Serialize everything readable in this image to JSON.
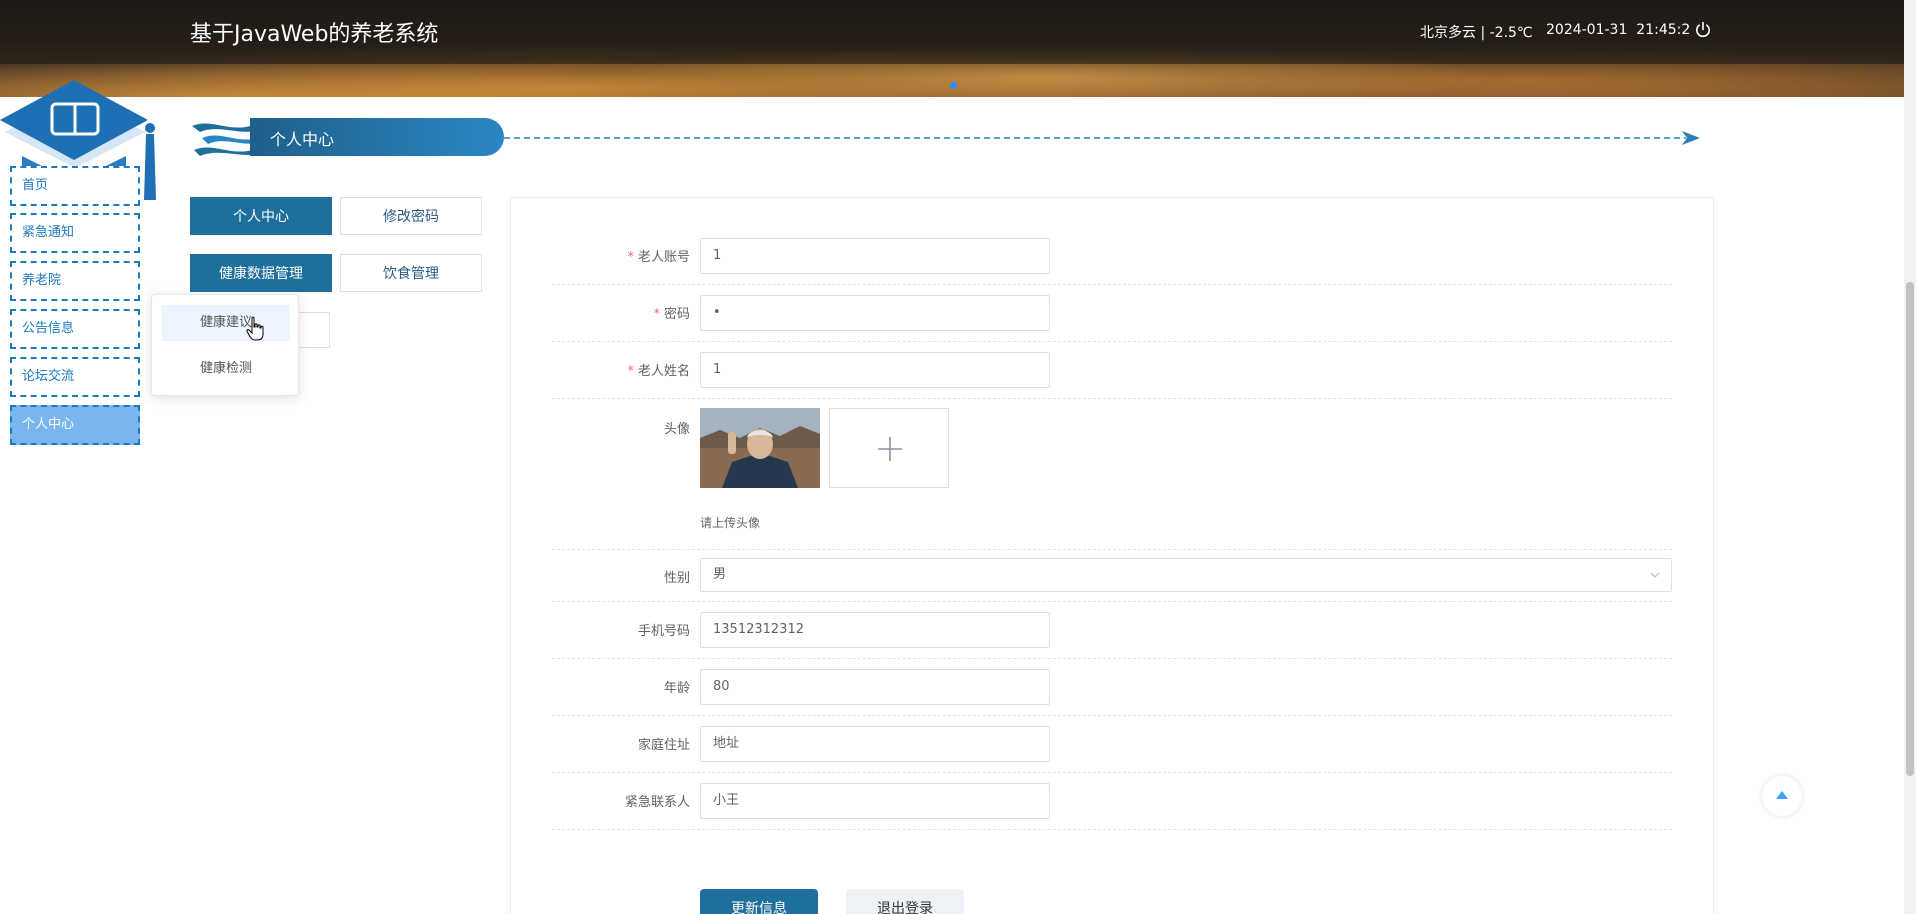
{
  "header": {
    "site_title": "基于JavaWeb的养老系统",
    "weather": "北京多云 | -2.5℃",
    "date": "2024-01-31",
    "time": "21:45:2"
  },
  "sidebar": {
    "items": [
      {
        "label": "首页"
      },
      {
        "label": "紧急通知"
      },
      {
        "label": "养老院"
      },
      {
        "label": "公告信息"
      },
      {
        "label": "论坛交流"
      },
      {
        "label": "个人中心",
        "active": true
      }
    ]
  },
  "section": {
    "title": "个人中心"
  },
  "tabs": {
    "personal_center": "个人中心",
    "change_password": "修改密码",
    "health_data": "健康数据管理",
    "diet": "饮食管理"
  },
  "dropdown": {
    "items": [
      "健康建议",
      "健康检测"
    ]
  },
  "form": {
    "account_label": "老人账号",
    "account_value": "1",
    "password_label": "密码",
    "password_value": "•",
    "name_label": "老人姓名",
    "name_value": "1",
    "avatar_label": "头像",
    "avatar_hint": "请上传头像",
    "gender_label": "性别",
    "gender_value": "男",
    "phone_label": "手机号码",
    "phone_value": "13512312312",
    "age_label": "年龄",
    "age_value": "80",
    "address_label": "家庭住址",
    "address_value": "地址",
    "contact_label": "紧急联系人",
    "contact_value": "小王"
  },
  "buttons": {
    "update": "更新信息",
    "logout": "退出登录"
  },
  "colors": {
    "primary": "#1f6f9d",
    "sidebar_border": "#1a7bc4",
    "active_bg": "#7ab6ee",
    "required": "#f56c6c"
  }
}
